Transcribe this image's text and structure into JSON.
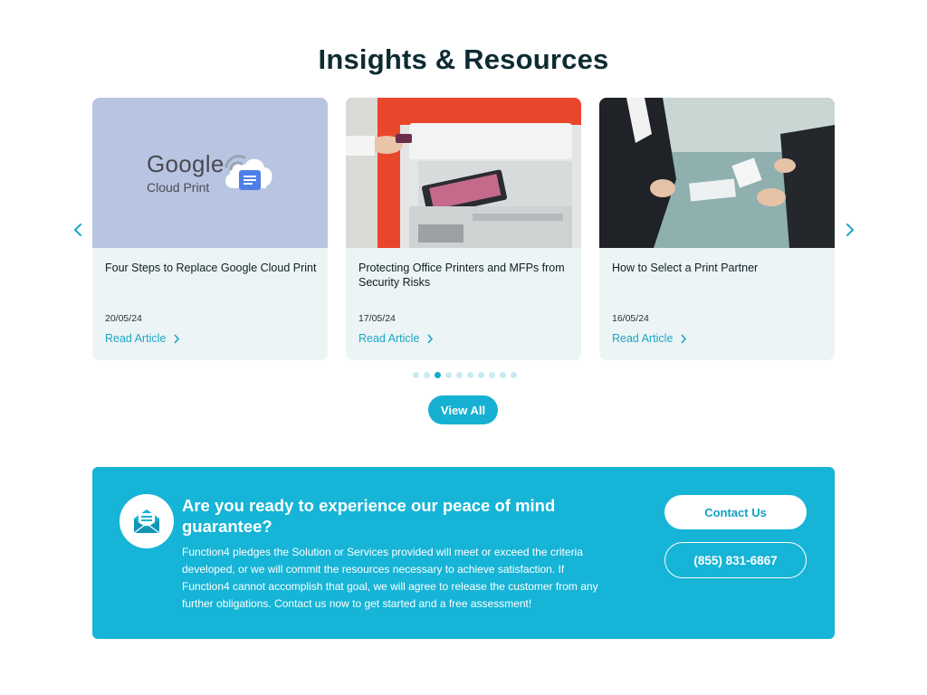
{
  "section": {
    "title": "Insights & Resources"
  },
  "carousel": {
    "prev_icon": "chevron-left-icon",
    "next_icon": "chevron-right-icon",
    "cards": [
      {
        "title": "Four Steps to Replace Google Cloud Print",
        "date": "20/05/24",
        "link_label": "Read Article",
        "image_text_main": "Google",
        "image_text_sub": "Cloud Print"
      },
      {
        "title": "Protecting Office Printers and MFPs from Security Risks",
        "date": "17/05/24",
        "link_label": "Read Article"
      },
      {
        "title": "How to Select a Print Partner",
        "date": "16/05/24",
        "link_label": "Read Article"
      }
    ],
    "dots_total": 10,
    "dots_active_index": 2
  },
  "view_all_label": "View All",
  "banner": {
    "heading": "Are you ready to experience our peace of mind guarantee?",
    "text": "Function4 pledges the Solution or Services provided will meet or exceed the criteria developed, or we will commit the resources necessary to achieve satisfaction. If Function4 cannot accomplish that goal, we will agree to release the customer from any further obligations. Contact us now to get started and a free assessment!",
    "contact_label": "Contact Us",
    "phone_label": "(855) 831-6867",
    "icon": "envelope-icon"
  },
  "colors": {
    "accent": "#16b4d6",
    "title": "#0d2b33",
    "card_bg": "#edf4f5",
    "link": "#1aa6c6"
  }
}
